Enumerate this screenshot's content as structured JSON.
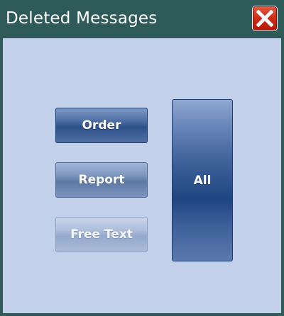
{
  "window": {
    "title": "Deleted Messages",
    "colors": {
      "titlebar": "#2f5a5a",
      "content_background": "#c3d0ea",
      "button_primary": "#2e5089",
      "close_button": "#cf2b14"
    }
  },
  "buttons": {
    "order": "Order",
    "report": "Report",
    "free_text": "Free Text",
    "all": "All"
  },
  "icons": {
    "close": "close-x-icon"
  }
}
